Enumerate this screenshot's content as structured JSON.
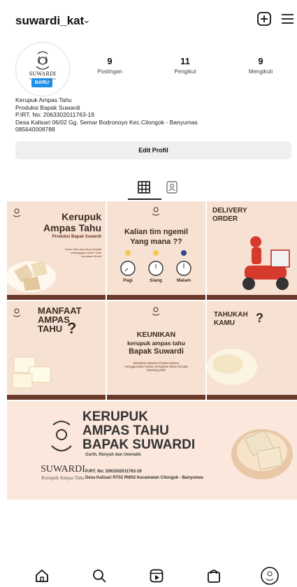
{
  "header": {
    "username": "suwardi_kat",
    "chevron": "⌄"
  },
  "avatar": {
    "brand": "SUWARDI",
    "sub": "Kerupuk Ampas Tahu",
    "badge": "BARU"
  },
  "stats": [
    {
      "num": "9",
      "label": "Postingan"
    },
    {
      "num": "11",
      "label": "Pengikut"
    },
    {
      "num": "9",
      "label": "Mengikuti"
    }
  ],
  "bio": [
    "Kerupuk Ampas Tahu",
    "Produksi Bapak Suwardi",
    "P.IRT. No: 2063302011763-19",
    "Desa Kalisari 06/02 Gg. Semar Bodronoyo Kec.Cilongok - Banyumas",
    "085640008788"
  ],
  "edit_button": "Edit Profil",
  "posts": {
    "p1": {
      "line1": "Kerupuk",
      "line2": "Ampas Tahu",
      "sub": "Produksi Bapak Suwardi",
      "text": "Kamu tahu apa yang menjadi kebanggaan kami? Yaitu kepuasan Anda!"
    },
    "p2": {
      "line1": "Kalian tim ngemil",
      "line2": "Yang mana ??",
      "pagi": "Pagi",
      "siang": "Siang",
      "malam": "Malam"
    },
    "p3": {
      "line1": "DELIVERY",
      "line2": "ORDER"
    },
    "p4": {
      "line1": "MANFAAT",
      "line2": "AMPAS",
      "line3": "TAHU",
      "q": "?"
    },
    "p5": {
      "line1": "KEUNIKAN",
      "line2": "kerupuk ampas tahu",
      "line3": "Bapak Suwardi",
      "text": "Bertahan selama 8 bulan karena menggunakan bahan pengawet alami berupa bawang putih"
    },
    "p6": {
      "line1": "TAHUKAH",
      "line2": "KAMU",
      "q": "?"
    },
    "p7": {
      "line1": "KERUPUK",
      "line2": "AMPAS TAHU",
      "line3": "BAPAK SUWARDI",
      "line4": "Gurih, Renyah dan Ueenakk",
      "brand": "SUWARDI",
      "brand_sub": "Kerupuk Ampas Tahu",
      "irt": "P.IRT. No: 2063302011763-19",
      "addr": "Desa Kalisari RT02 RW02 Kecamatan Cilongok - Banyumas"
    }
  },
  "colors": {
    "bg": "#f7e1d2",
    "brown": "#6b3a2a",
    "accent": "#1d8fe8"
  },
  "icons": [
    "chevron-down-icon",
    "plus-square-icon",
    "menu-icon",
    "grid-icon",
    "tagged-icon",
    "home-icon",
    "search-icon",
    "reels-icon",
    "shop-icon",
    "profile-icon"
  ]
}
